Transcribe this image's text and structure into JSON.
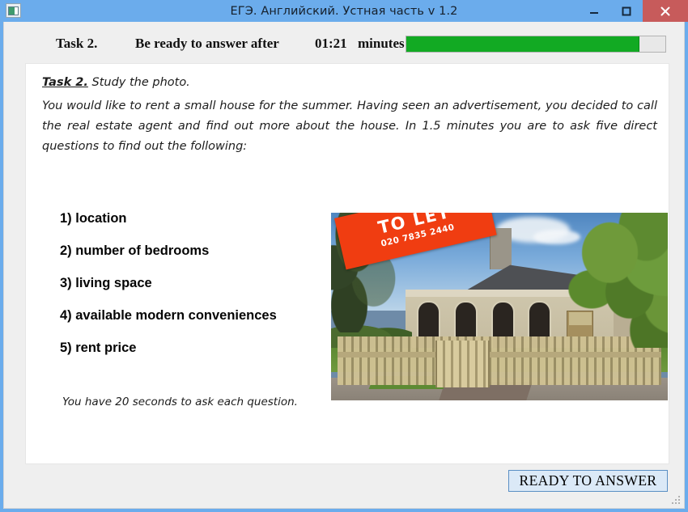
{
  "window": {
    "title": "ЕГЭ. Английский. Устная часть v 1.2",
    "app_icon": "application-window-icon",
    "controls": {
      "minimize": "minimize-icon",
      "maximize": "maximize-icon",
      "close": "close-icon"
    },
    "colors": {
      "titlebar": "#6bacec",
      "close_button": "#c75b5b",
      "client_background": "#efefef",
      "panel_background": "#ffffff",
      "progress_fill": "#12aa23",
      "button_face": "#dbe9f7",
      "button_border": "#5a8fc4",
      "sign": "#f03d11"
    }
  },
  "toolbar": {
    "task_label": "Task 2.",
    "instruction": "Be ready to answer after",
    "time_remaining": "01:21",
    "time_units": "minutes",
    "progress_percent": 90
  },
  "content": {
    "heading_strong": "Task 2.",
    "heading_rest": " Study the photo.",
    "intro": "You would like to rent a small house for the summer. Having seen an advertisement, you decided to call the real estate agent and find out more about the house. In 1.5 minutes you are to ask five direct questions to find out the following:",
    "questions": [
      "1) location",
      "2) number of bedrooms",
      "3) living space",
      "4) available modern conveniences",
      "5) rent price"
    ],
    "footnote": "You have 20 seconds to ask each question.",
    "photo": {
      "alt": "photo-of-house-with-to-let-sign",
      "sign_title": "TO LET",
      "sign_phone": "020 7835 2440"
    }
  },
  "footer": {
    "ready_button": "READY TO ANSWER"
  }
}
